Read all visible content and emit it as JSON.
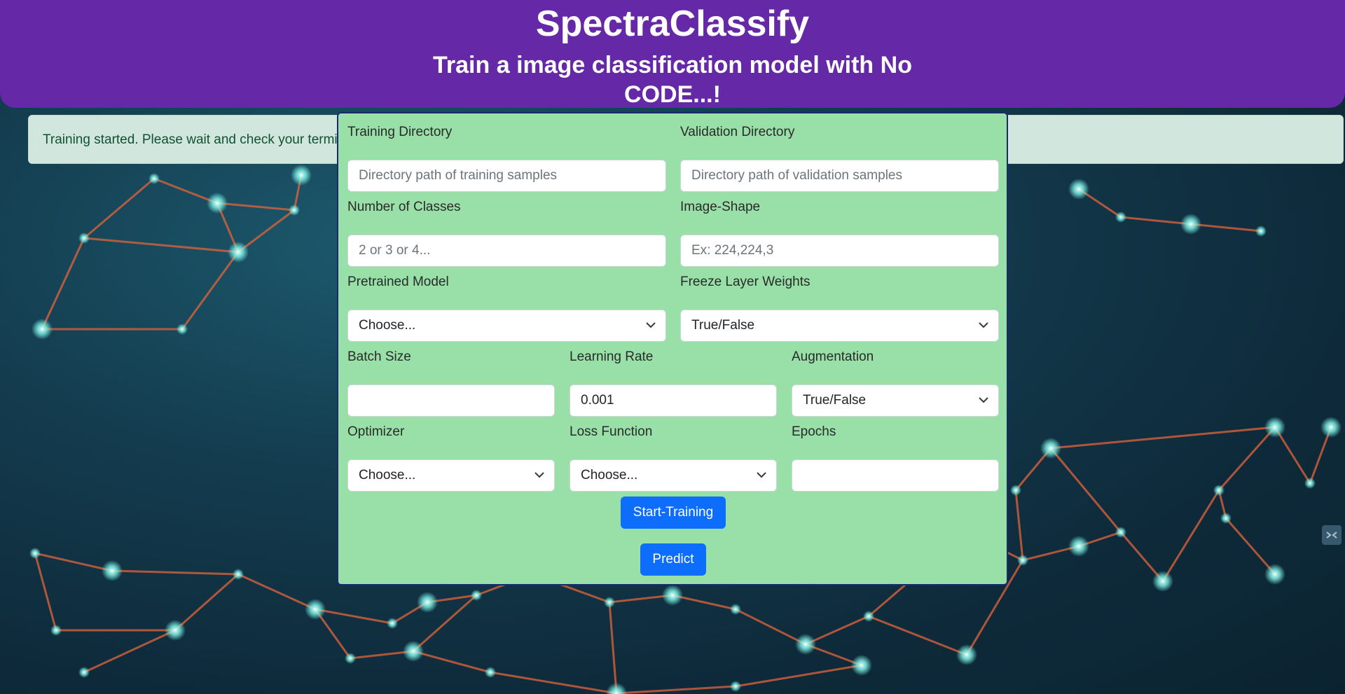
{
  "header": {
    "title": "SpectraClassify",
    "subtitle": "Train a image classification model with No CODE...!"
  },
  "alert": {
    "text": "Training started. Please wait and check your terminal for progress."
  },
  "form": {
    "training_dir": {
      "label": "Training Directory",
      "placeholder": "Directory path of training samples",
      "value": ""
    },
    "validation_dir": {
      "label": "Validation Directory",
      "placeholder": "Directory path of validation samples",
      "value": ""
    },
    "num_classes": {
      "label": "Number of Classes",
      "placeholder": "2 or 3 or 4...",
      "value": ""
    },
    "image_shape": {
      "label": "Image-Shape",
      "placeholder": "Ex: 224,224,3",
      "value": ""
    },
    "pretrained_model": {
      "label": "Pretrained Model",
      "selected": "Choose..."
    },
    "freeze_layers": {
      "label": "Freeze Layer Weights",
      "selected": "True/False"
    },
    "batch_size": {
      "label": "Batch Size",
      "value": ""
    },
    "learning_rate": {
      "label": "Learning Rate",
      "value": "0.001"
    },
    "augmentation": {
      "label": "Augmentation",
      "selected": "True/False"
    },
    "optimizer": {
      "label": "Optimizer",
      "selected": "Choose..."
    },
    "loss_function": {
      "label": "Loss Function",
      "selected": "Choose..."
    },
    "epochs": {
      "label": "Epochs",
      "value": ""
    }
  },
  "buttons": {
    "start_training": "Start-Training",
    "predict": "Predict"
  },
  "colors": {
    "header_bg": "#6528a7",
    "form_bg": "#98e0a8",
    "alert_bg": "#d1e7dd",
    "button_primary": "#0d6efd",
    "network_lines": "#e2643a",
    "network_nodes": "#7df5e8"
  },
  "icons": {
    "select_arrow": "chevron-down-icon",
    "side_tool": "collapse-arrows-icon"
  }
}
